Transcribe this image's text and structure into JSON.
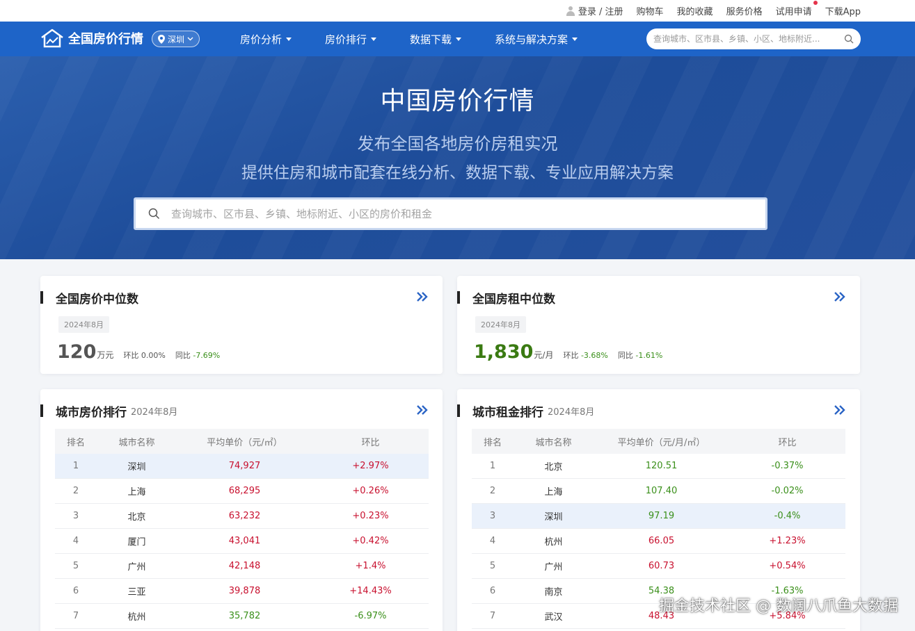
{
  "topbar": {
    "links": [
      "登录 / 注册",
      "购物车",
      "我的收藏",
      "服务价格",
      "试用申请",
      "下载App"
    ]
  },
  "nav": {
    "logo_text": "全国房价行情",
    "city": "深圳",
    "menu": [
      "房价分析",
      "房价排行",
      "数据下载",
      "系统与解决方案"
    ],
    "search_placeholder": "查询城市、区市县、乡镇、小区、地标附近..."
  },
  "hero": {
    "title": "中国房价行情",
    "subtitle1": "发布全国各地房价房租实况",
    "subtitle2": "提供住房和城市配套在线分析、数据下载、专业应用解决方案",
    "search_placeholder": "查询城市、区市县、乡镇、地标附近、小区的房价和租金"
  },
  "price_median": {
    "title": "全国房价中位数",
    "date": "2024年8月",
    "value": "120",
    "unit": "万元",
    "mom_label": "环比",
    "mom": "0.00%",
    "yoy_label": "同比",
    "yoy": "-7.69%"
  },
  "rent_median": {
    "title": "全国房租中位数",
    "date": "2024年8月",
    "value": "1,830",
    "unit": "元/月",
    "mom_label": "环比",
    "mom": "-3.68%",
    "yoy_label": "同比",
    "yoy": "-1.61%"
  },
  "price_rank": {
    "title": "城市房价排行",
    "date": "2024年8月",
    "headers": [
      "排名",
      "城市名称",
      "平均单价（元/㎡）",
      "环比"
    ],
    "rows": [
      {
        "rank": "1",
        "city": "深圳",
        "price": "74,927",
        "change": "+2.97%"
      },
      {
        "rank": "2",
        "city": "上海",
        "price": "68,295",
        "change": "+0.26%"
      },
      {
        "rank": "3",
        "city": "北京",
        "price": "63,232",
        "change": "+0.23%"
      },
      {
        "rank": "4",
        "city": "厦门",
        "price": "43,041",
        "change": "+0.42%"
      },
      {
        "rank": "5",
        "city": "广州",
        "price": "42,148",
        "change": "+1.4%"
      },
      {
        "rank": "6",
        "city": "三亚",
        "price": "39,878",
        "change": "+14.43%"
      },
      {
        "rank": "7",
        "city": "杭州",
        "price": "35,782",
        "change": "-6.97%"
      }
    ]
  },
  "rent_rank": {
    "title": "城市租金排行",
    "date": "2024年8月",
    "headers": [
      "排名",
      "城市名称",
      "平均单价（元/月/㎡）",
      "环比"
    ],
    "rows": [
      {
        "rank": "1",
        "city": "北京",
        "price": "120.51",
        "change": "-0.37%"
      },
      {
        "rank": "2",
        "city": "上海",
        "price": "107.40",
        "change": "-0.02%"
      },
      {
        "rank": "3",
        "city": "深圳",
        "price": "97.19",
        "change": "-0.4%"
      },
      {
        "rank": "4",
        "city": "杭州",
        "price": "66.05",
        "change": "+1.23%"
      },
      {
        "rank": "5",
        "city": "广州",
        "price": "60.73",
        "change": "+0.54%"
      },
      {
        "rank": "6",
        "city": "南京",
        "price": "54.38",
        "change": "-1.63%"
      },
      {
        "rank": "7",
        "city": "武汉",
        "price": "48.43",
        "change": "+5.84%"
      }
    ]
  },
  "watermark": "掘金技术社区 @ 数阔八爪鱼大数据",
  "colors": {
    "nav": "#1e64c8",
    "up": "#c8102e",
    "down": "#3a8f1a"
  }
}
